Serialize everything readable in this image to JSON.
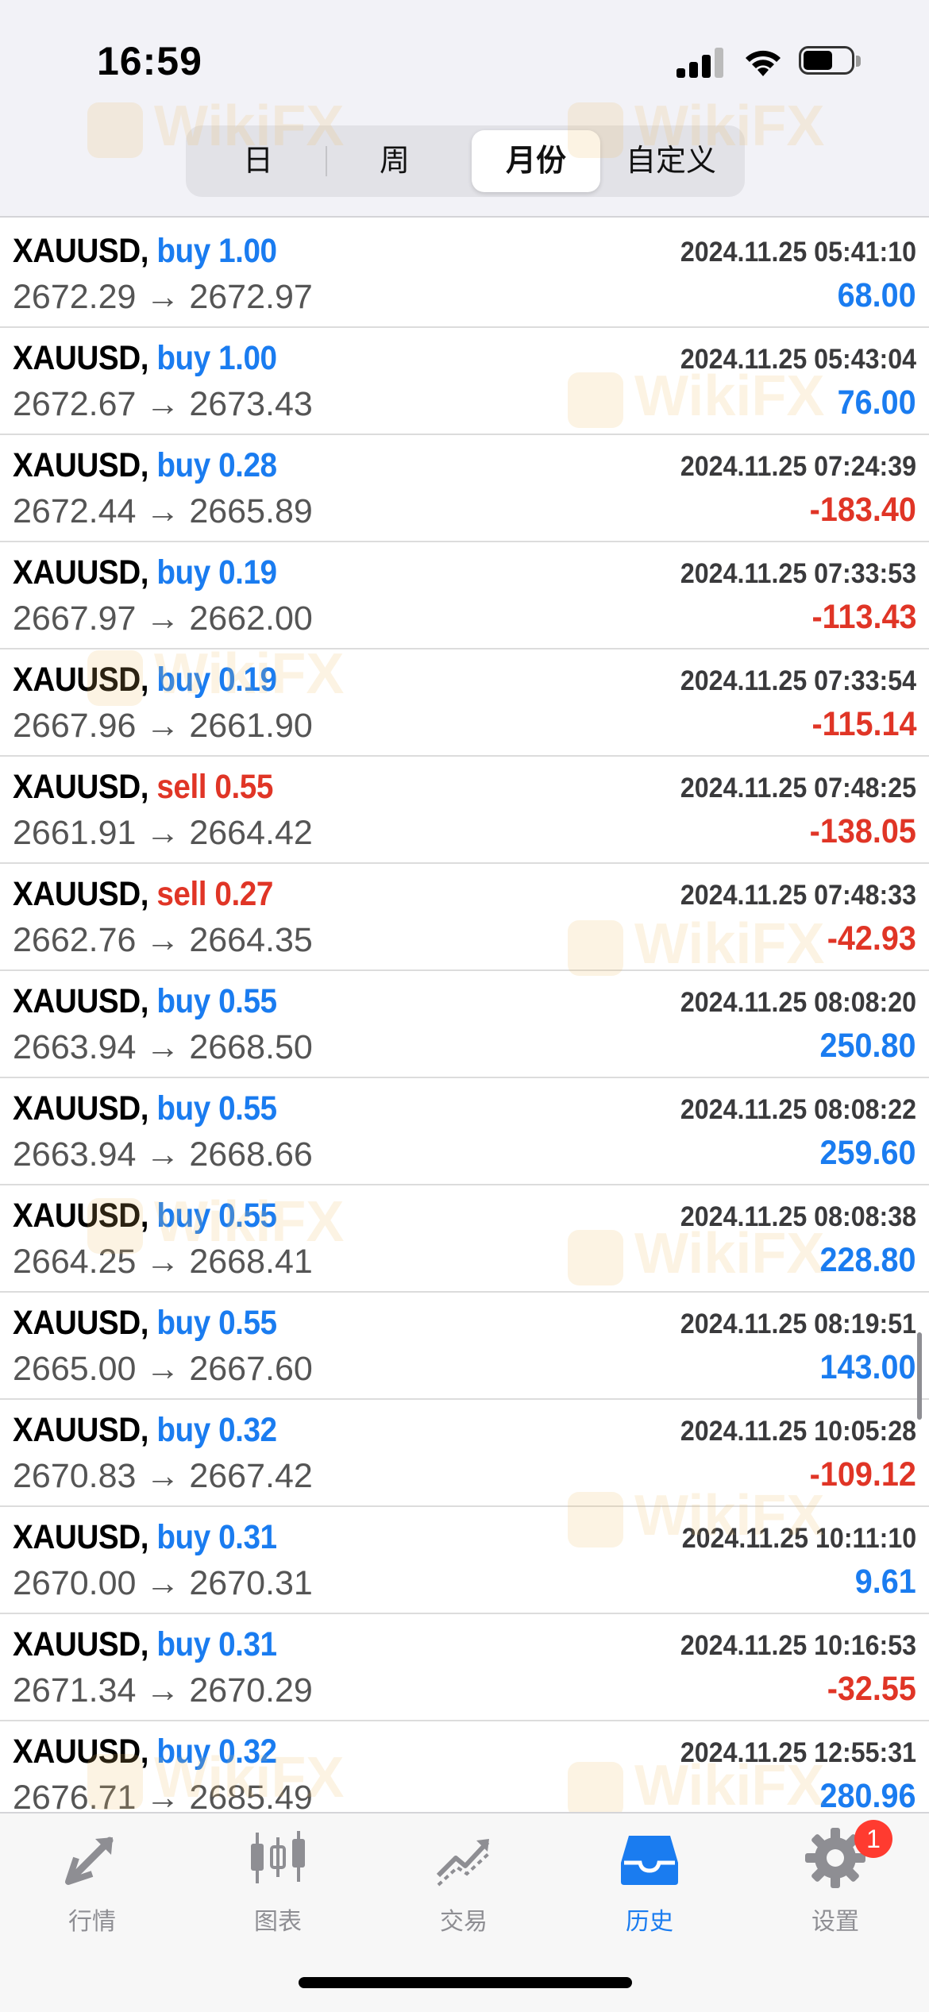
{
  "status_bar": {
    "time": "16:59"
  },
  "period_tabs": [
    {
      "label": "日",
      "active": false
    },
    {
      "label": "周",
      "active": false
    },
    {
      "label": "月份",
      "active": true
    },
    {
      "label": "自定义",
      "active": false
    }
  ],
  "watermark_text": "WikiFX",
  "arrow": "→",
  "deals": [
    {
      "symbol": "XAUUSD,",
      "side": "buy",
      "volume": "1.00",
      "datetime": "2024.11.25 05:41:10",
      "open": "2672.29",
      "close": "2672.97",
      "profit": "68.00"
    },
    {
      "symbol": "XAUUSD,",
      "side": "buy",
      "volume": "1.00",
      "datetime": "2024.11.25 05:43:04",
      "open": "2672.67",
      "close": "2673.43",
      "profit": "76.00"
    },
    {
      "symbol": "XAUUSD,",
      "side": "buy",
      "volume": "0.28",
      "datetime": "2024.11.25 07:24:39",
      "open": "2672.44",
      "close": "2665.89",
      "profit": "-183.40"
    },
    {
      "symbol": "XAUUSD,",
      "side": "buy",
      "volume": "0.19",
      "datetime": "2024.11.25 07:33:53",
      "open": "2667.97",
      "close": "2662.00",
      "profit": "-113.43"
    },
    {
      "symbol": "XAUUSD,",
      "side": "buy",
      "volume": "0.19",
      "datetime": "2024.11.25 07:33:54",
      "open": "2667.96",
      "close": "2661.90",
      "profit": "-115.14"
    },
    {
      "symbol": "XAUUSD,",
      "side": "sell",
      "volume": "0.55",
      "datetime": "2024.11.25 07:48:25",
      "open": "2661.91",
      "close": "2664.42",
      "profit": "-138.05"
    },
    {
      "symbol": "XAUUSD,",
      "side": "sell",
      "volume": "0.27",
      "datetime": "2024.11.25 07:48:33",
      "open": "2662.76",
      "close": "2664.35",
      "profit": "-42.93"
    },
    {
      "symbol": "XAUUSD,",
      "side": "buy",
      "volume": "0.55",
      "datetime": "2024.11.25 08:08:20",
      "open": "2663.94",
      "close": "2668.50",
      "profit": "250.80"
    },
    {
      "symbol": "XAUUSD,",
      "side": "buy",
      "volume": "0.55",
      "datetime": "2024.11.25 08:08:22",
      "open": "2663.94",
      "close": "2668.66",
      "profit": "259.60"
    },
    {
      "symbol": "XAUUSD,",
      "side": "buy",
      "volume": "0.55",
      "datetime": "2024.11.25 08:08:38",
      "open": "2664.25",
      "close": "2668.41",
      "profit": "228.80"
    },
    {
      "symbol": "XAUUSD,",
      "side": "buy",
      "volume": "0.55",
      "datetime": "2024.11.25 08:19:51",
      "open": "2665.00",
      "close": "2667.60",
      "profit": "143.00"
    },
    {
      "symbol": "XAUUSD,",
      "side": "buy",
      "volume": "0.32",
      "datetime": "2024.11.25 10:05:28",
      "open": "2670.83",
      "close": "2667.42",
      "profit": "-109.12"
    },
    {
      "symbol": "XAUUSD,",
      "side": "buy",
      "volume": "0.31",
      "datetime": "2024.11.25 10:11:10",
      "open": "2670.00",
      "close": "2670.31",
      "profit": "9.61"
    },
    {
      "symbol": "XAUUSD,",
      "side": "buy",
      "volume": "0.31",
      "datetime": "2024.11.25 10:16:53",
      "open": "2671.34",
      "close": "2670.29",
      "profit": "-32.55"
    },
    {
      "symbol": "XAUUSD,",
      "side": "buy",
      "volume": "0.32",
      "datetime": "2024.11.25 12:55:31",
      "open": "2676.71",
      "close": "2685.49",
      "profit": "280.96"
    }
  ],
  "bottom_tabs": [
    {
      "label": "行情",
      "icon": "quotes-arrows-icon",
      "active": false
    },
    {
      "label": "图表",
      "icon": "candlestick-chart-icon",
      "active": false
    },
    {
      "label": "交易",
      "icon": "trade-chart-icon",
      "active": false
    },
    {
      "label": "历史",
      "icon": "history-inbox-icon",
      "active": true
    },
    {
      "label": "设置",
      "icon": "gear-icon",
      "active": false,
      "badge": "1"
    }
  ],
  "colors": {
    "buy": "#1a7cf0",
    "sell": "#e03526",
    "active_tab": "#1a7cf0",
    "badge": "#ff3b30"
  }
}
